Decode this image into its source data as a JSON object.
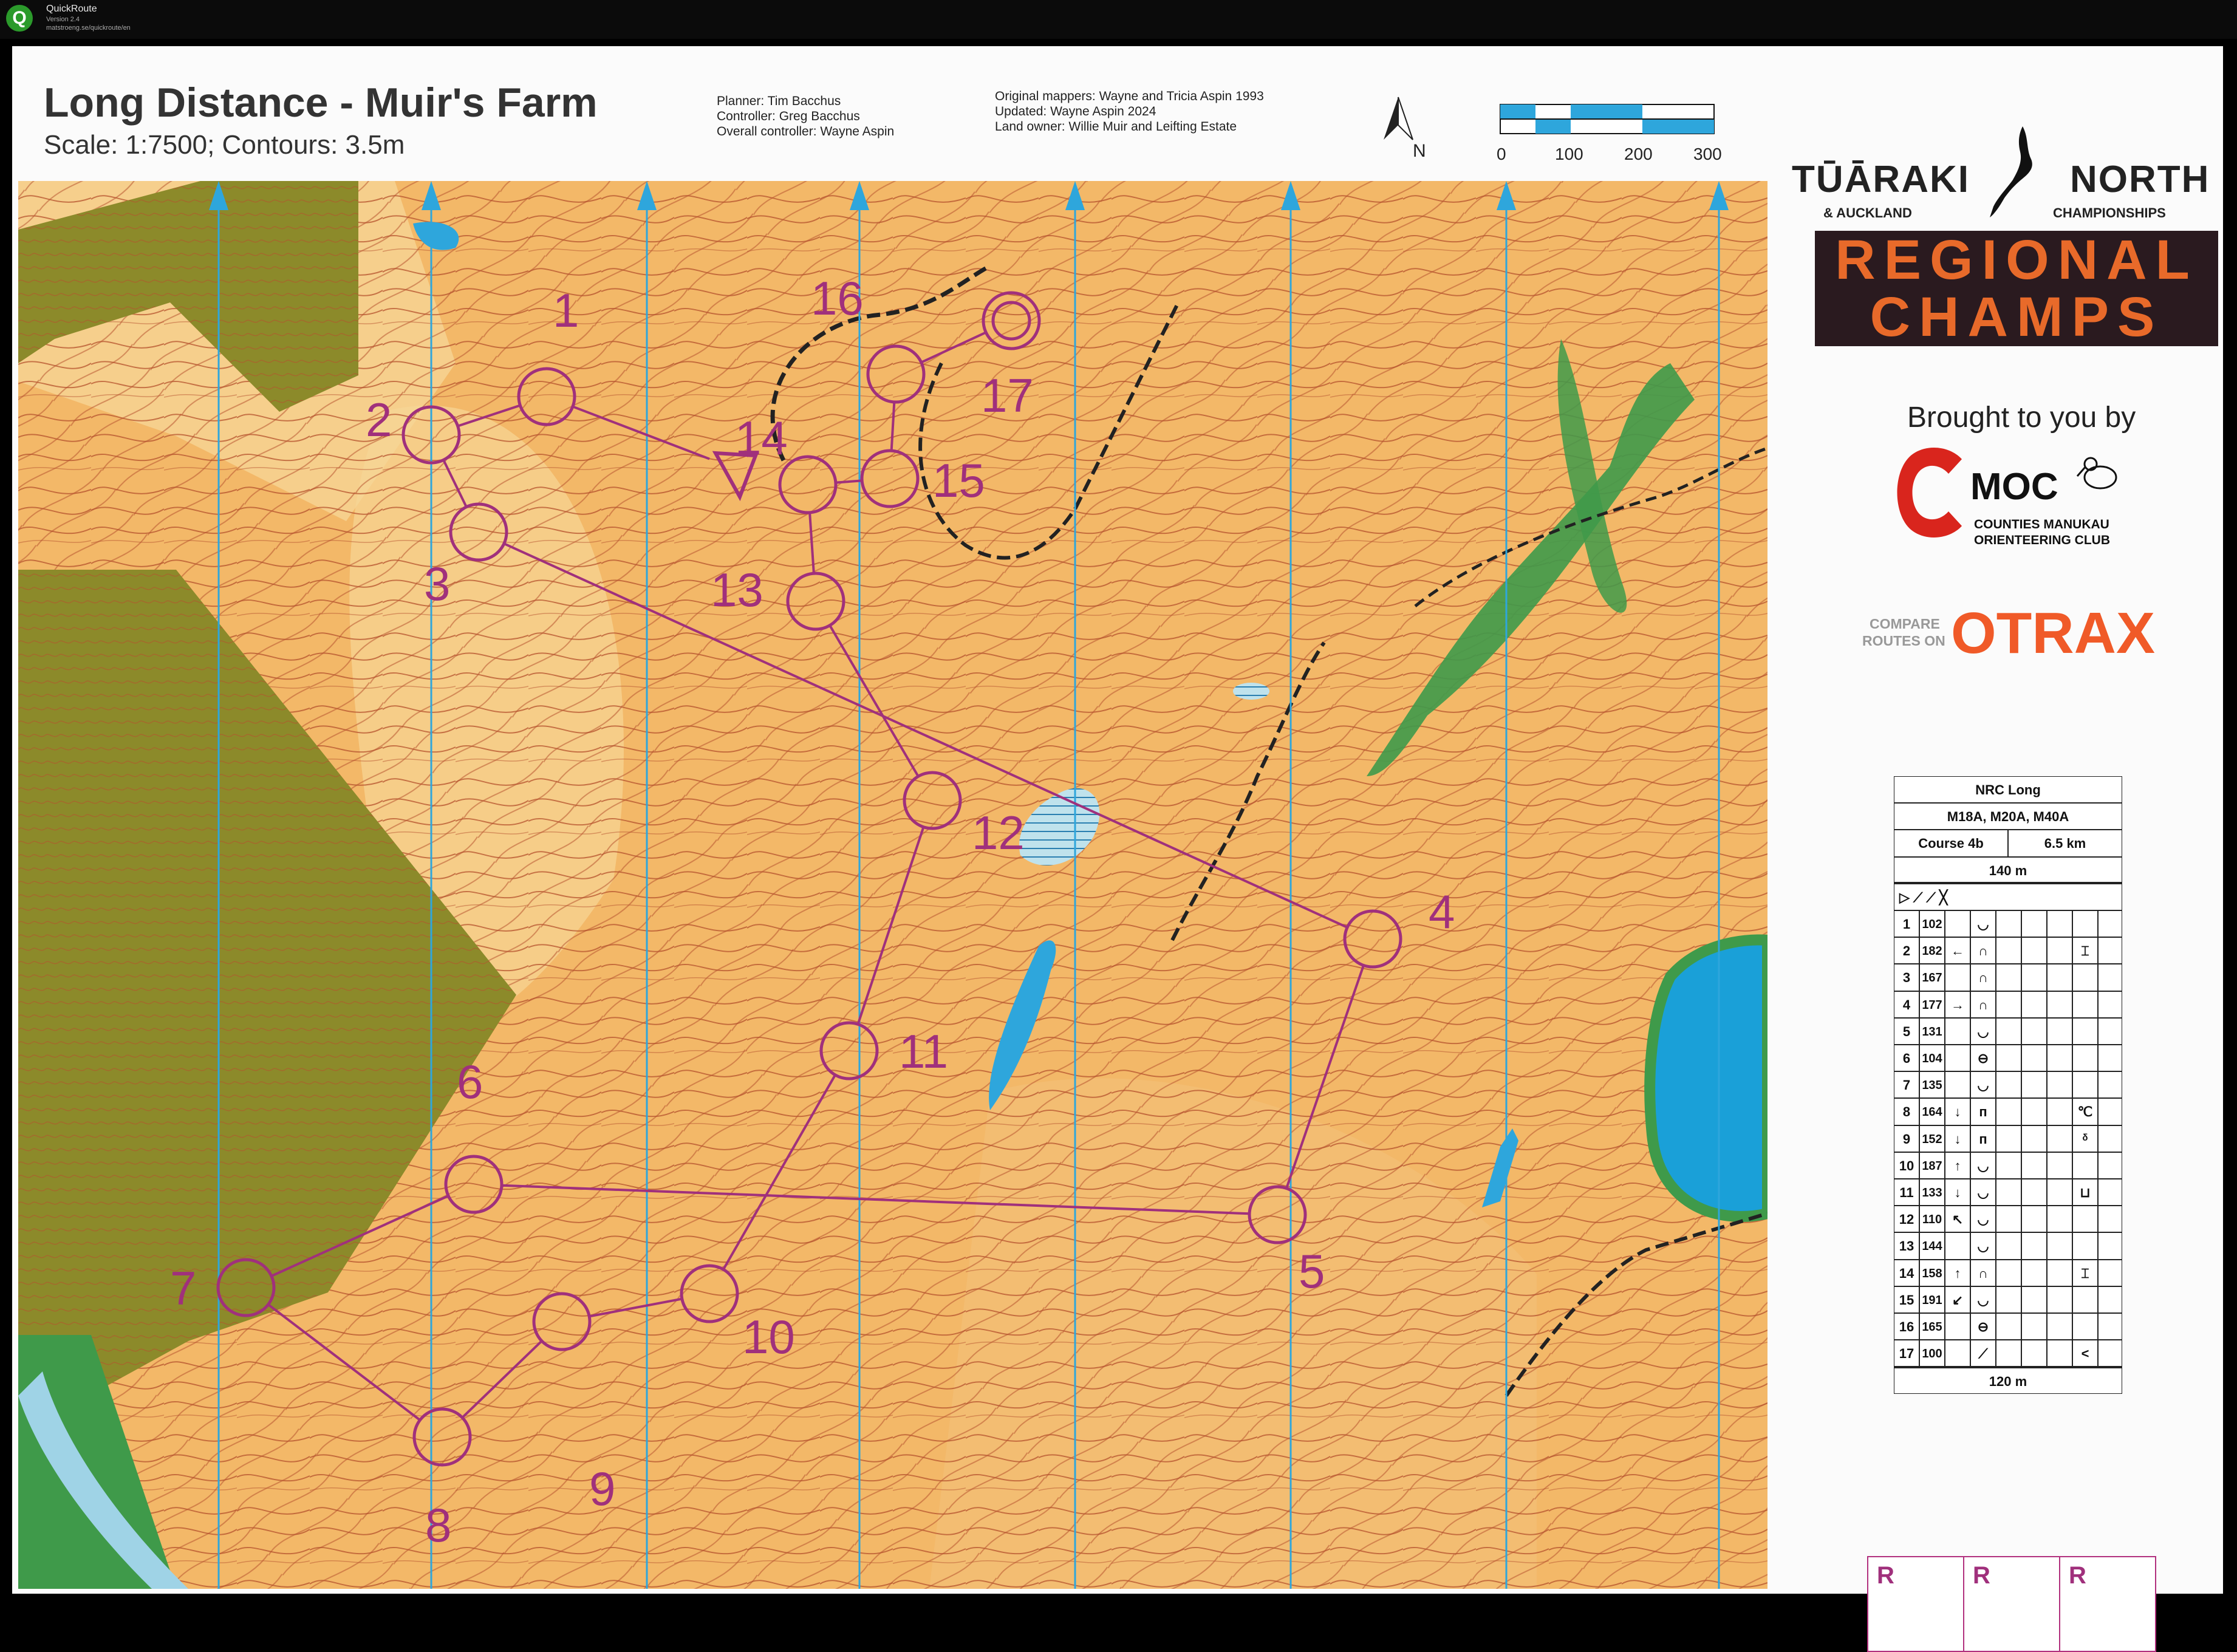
{
  "window": {
    "app_name": "QuickRoute",
    "version": "Version 2.4",
    "url": "matstroeng.se/quickroute/en"
  },
  "map_header": {
    "title": "Long Distance - Muir's Farm",
    "scale": "Scale: 1:7500; Contours: 3.5m",
    "planner": "Planner: Tim Bacchus",
    "controller": "Controller: Greg Bacchus",
    "overall_controller": "Overall controller: Wayne Aspin",
    "original_mappers": "Original mappers: Wayne and Tricia Aspin 1993",
    "updated": "Updated: Wayne Aspin 2024",
    "land_owner": "Land owner: Willie Muir and Leifting Estate",
    "north": "N",
    "scale_bar": [
      "0",
      "100",
      "200",
      "300"
    ]
  },
  "event": {
    "line1_left": "TŪĀRAKI",
    "line1_right": "NORTH",
    "line2_left": "& AUCKLAND",
    "line2_right": "CHAMPIONSHIPS",
    "banner_line1": "REGIONAL",
    "banner_line2": "CHAMPS",
    "brought_by": "Brought to you by",
    "club_abbrev": "MOC",
    "club_name_1": "COUNTIES MANUKAU",
    "club_name_2": "ORIENTEERING CLUB",
    "compare_1": "COMPARE",
    "compare_2": "ROUTES ON",
    "otrax": "OTRAX"
  },
  "control_descriptions": {
    "event_name": "NRC Long",
    "classes": "M18A, M20A, M40A",
    "course": "Course 4b",
    "length": "6.5 km",
    "start_leg": "140 m",
    "finish_leg": "120 m",
    "rows": [
      {
        "n": "1",
        "code": "102",
        "dir": "",
        "feat": "◡",
        "extra": ""
      },
      {
        "n": "2",
        "code": "182",
        "dir": "←",
        "feat": "∩",
        "extra": "⌶"
      },
      {
        "n": "3",
        "code": "167",
        "dir": "",
        "feat": "∩",
        "extra": ""
      },
      {
        "n": "4",
        "code": "177",
        "dir": "→",
        "feat": "∩",
        "extra": ""
      },
      {
        "n": "5",
        "code": "131",
        "dir": "",
        "feat": "◡",
        "extra": ""
      },
      {
        "n": "6",
        "code": "104",
        "dir": "",
        "feat": "⊖",
        "extra": ""
      },
      {
        "n": "7",
        "code": "135",
        "dir": "",
        "feat": "◡",
        "extra": ""
      },
      {
        "n": "8",
        "code": "164",
        "dir": "↓",
        "feat": "ᴨ",
        "extra": "℃"
      },
      {
        "n": "9",
        "code": "152",
        "dir": "↓",
        "feat": "ᴨ",
        "extra": "ᵟ"
      },
      {
        "n": "10",
        "code": "187",
        "dir": "↑",
        "feat": "◡",
        "extra": ""
      },
      {
        "n": "11",
        "code": "133",
        "dir": "↓",
        "feat": "◡",
        "extra": "⊔"
      },
      {
        "n": "12",
        "code": "110",
        "dir": "↖",
        "feat": "◡",
        "extra": ""
      },
      {
        "n": "13",
        "code": "144",
        "dir": "",
        "feat": "◡",
        "extra": ""
      },
      {
        "n": "14",
        "code": "158",
        "dir": "↑",
        "feat": "∩",
        "extra": "⌶"
      },
      {
        "n": "15",
        "code": "191",
        "dir": "↙",
        "feat": "◡",
        "extra": ""
      },
      {
        "n": "16",
        "code": "165",
        "dir": "",
        "feat": "⊖",
        "extra": ""
      },
      {
        "n": "17",
        "code": "100",
        "dir": "",
        "feat": "⟋",
        "extra": "<"
      }
    ]
  },
  "reserve_boxes": [
    "R",
    "R",
    "R"
  ],
  "course": {
    "color": "#a0307c",
    "start_label": "",
    "controls": [
      {
        "label": "1"
      },
      {
        "label": "2"
      },
      {
        "label": "3"
      },
      {
        "label": "4"
      },
      {
        "label": "5"
      },
      {
        "label": "6"
      },
      {
        "label": "7"
      },
      {
        "label": "8"
      },
      {
        "label": "9"
      },
      {
        "label": "10"
      },
      {
        "label": "11"
      },
      {
        "label": "12"
      },
      {
        "label": "13"
      },
      {
        "label": "14"
      },
      {
        "label": "15"
      },
      {
        "label": "16"
      },
      {
        "label": "17"
      }
    ]
  },
  "colors": {
    "open_land": "#f3b868",
    "rough_open": "#f6cf8c",
    "forest_green": "#8c8a2a",
    "vegetation_green": "#3f9a4a",
    "water": "#2ea6dc",
    "contour": "#b5522d",
    "accent": "#e86a2a"
  }
}
